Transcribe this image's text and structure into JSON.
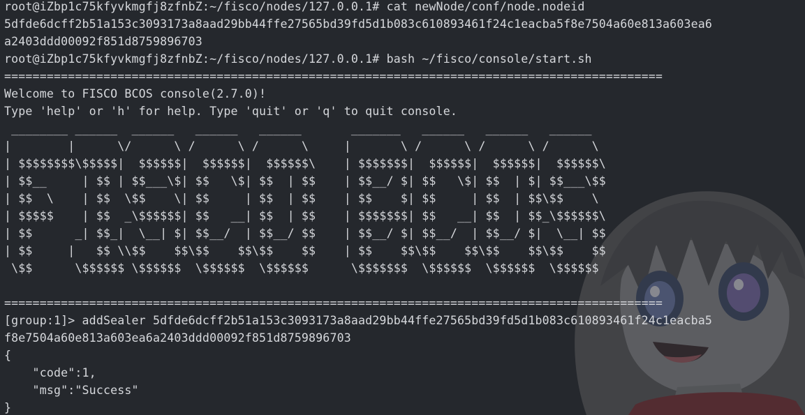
{
  "terminal": {
    "lines": [
      "root@iZbp1c75kfyvkmgfj8zfnbZ:~/fisco/nodes/127.0.0.1# cat newNode/conf/node.nodeid",
      "5dfde6dcff2b51a153c3093173a8aad29bb44ffe27565bd39fd5d1b083c610893461f24c1eacba5f8e7504a60e813a603ea6",
      "a2403ddd00092f851d8759896703",
      "root@iZbp1c75kfyvkmgfj8zfnbZ:~/fisco/nodes/127.0.0.1# bash ~/fisco/console/start.sh",
      "=============================================================================================",
      "Welcome to FISCO BCOS console(2.7.0)!",
      "Type 'help' or 'h' for help. Type 'quit' or 'q' to quit console.",
      " ________ ______  ______   ______   ______       _______   ______   ______   ______",
      "|        |      \\/      \\ /      \\ /      \\     |       \\ /      \\ /      \\ /      \\",
      "| $$$$$$$$\\$$$$$|  $$$$$$|  $$$$$$|  $$$$$$\\    | $$$$$$$|  $$$$$$|  $$$$$$|  $$$$$$\\",
      "| $$__     | $$ | $$___\\$| $$   \\$| $$  | $$    | $$__/ $| $$   \\$| $$  | $| $$___\\$$",
      "| $$  \\    | $$  \\$$    \\| $$     | $$  | $$    | $$    $| $$     | $$  | $$\\$$    \\",
      "| $$$$$    | $$  _\\$$$$$$| $$   __| $$  | $$    | $$$$$$$| $$   __| $$  | $$_\\$$$$$$\\",
      "| $$      _| $$_|  \\__| $| $$__/  | $$__/ $$    | $$__/ $| $$__/  | $$__/ $|  \\__| $$",
      "| $$     |   $$ \\\\$$    $$\\$$    $$\\$$    $$    | $$    $$\\$$    $$\\$$    $$\\$$    $$",
      " \\$$      \\$$$$$$ \\$$$$$$  \\$$$$$$  \\$$$$$$      \\$$$$$$$  \\$$$$$$  \\$$$$$$  \\$$$$$$",
      "",
      "=============================================================================================",
      "[group:1]> addSealer 5dfde6dcff2b51a153c3093173a8aad29bb44ffe27565bd39fd5d1b083c610893461f24c1eacba5",
      "f8e7504a60e813a603ea6a2403ddd00092f851d8759896703",
      "{",
      "    \"code\":1,",
      "    \"msg\":\"Success\"",
      "}"
    ]
  }
}
